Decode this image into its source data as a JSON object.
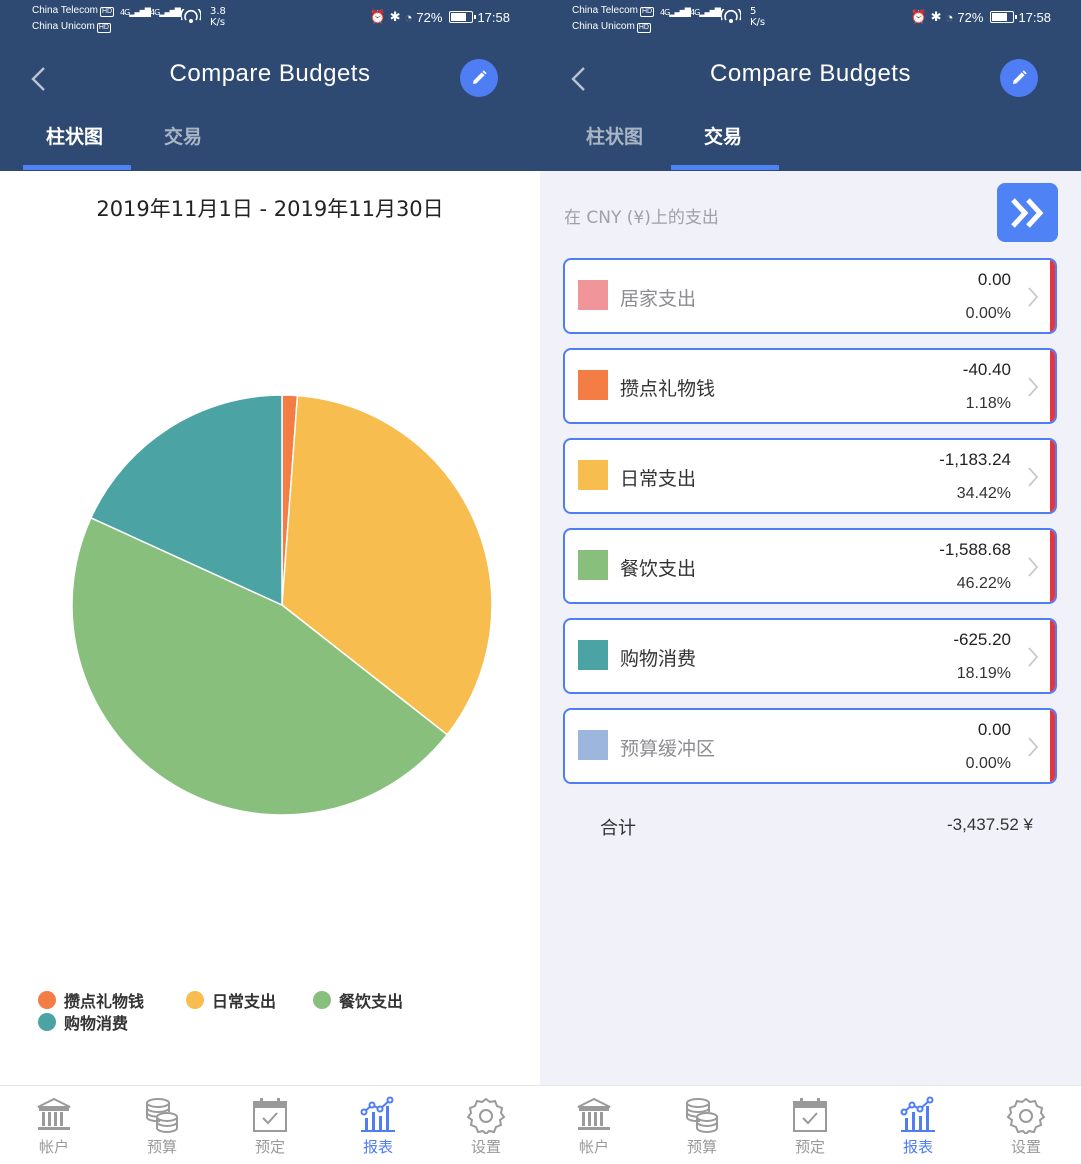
{
  "status_bar": {
    "carrier1": "China Telecom",
    "carrier2": "China Unicom",
    "hd": "HD",
    "network": "4G",
    "left_speed_value": "3.8",
    "right_speed_value": "5",
    "speed_unit": "K/s",
    "battery": "72%",
    "time": "17:58"
  },
  "header": {
    "title": "Compare Budgets",
    "tabs": [
      "柱状图",
      "交易"
    ]
  },
  "left_screen": {
    "date_range": "2019年11月1日 - 2019年11月30日",
    "legend": [
      {
        "label": "攒点礼物钱",
        "color": "#f47c45"
      },
      {
        "label": "日常支出",
        "color": "#f7bd4f"
      },
      {
        "label": "餐饮支出",
        "color": "#88bf7d"
      },
      {
        "label": "购物消费",
        "color": "#4ba3a3"
      }
    ]
  },
  "chart_data": {
    "type": "pie",
    "slices": [
      {
        "label": "攒点礼物钱",
        "value": 40.4,
        "percent": 1.18,
        "color": "#f47c45"
      },
      {
        "label": "日常支出",
        "value": 1183.24,
        "percent": 34.42,
        "color": "#f7bd4f"
      },
      {
        "label": "餐饮支出",
        "value": 1588.68,
        "percent": 46.22,
        "color": "#88bf7d"
      },
      {
        "label": "购物消费",
        "value": 625.2,
        "percent": 18.19,
        "color": "#4ba3a3"
      }
    ],
    "start": "top",
    "direction": "clockwise",
    "legend_position": "bottom-left"
  },
  "right_screen": {
    "currency_label": "在 CNY (¥)上的支出",
    "categories": [
      {
        "name": "居家支出",
        "amount": "0.00",
        "percent": "0.00%",
        "color": "#f0969b",
        "muted": true
      },
      {
        "name": "攒点礼物钱",
        "amount": "-40.40",
        "percent": "1.18%",
        "color": "#f47c45",
        "muted": false
      },
      {
        "name": "日常支出",
        "amount": "-1,183.24",
        "percent": "34.42%",
        "color": "#f7bd4f",
        "muted": false
      },
      {
        "name": "餐饮支出",
        "amount": "-1,588.68",
        "percent": "46.22%",
        "color": "#88bf7d",
        "muted": false
      },
      {
        "name": "购物消费",
        "amount": "-625.20",
        "percent": "18.19%",
        "color": "#4ba3a3",
        "muted": false
      },
      {
        "name": "预算缓冲区",
        "amount": "0.00",
        "percent": "0.00%",
        "color": "#9db6dd",
        "muted": true
      }
    ],
    "total_label": "合计",
    "total_value": "-3,437.52 ¥"
  },
  "bottom_nav": [
    {
      "label": "帐户",
      "icon": "bank-icon",
      "active": false
    },
    {
      "label": "预算",
      "icon": "coins-icon",
      "active": false
    },
    {
      "label": "预定",
      "icon": "calendar-check-icon",
      "active": false
    },
    {
      "label": "报表",
      "icon": "chart-icon",
      "active": true
    },
    {
      "label": "设置",
      "icon": "gear-icon",
      "active": false
    }
  ],
  "colors": {
    "header": "#2e4a73",
    "accent": "#4f7df4",
    "overspend_bar": "#e8343d"
  }
}
